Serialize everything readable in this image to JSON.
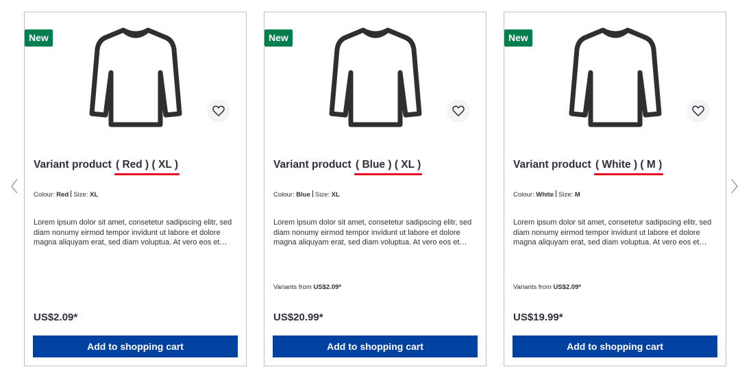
{
  "slider": {
    "prev_icon": "chevron-left-icon",
    "next_icon": "chevron-right-icon"
  },
  "products": [
    {
      "badge": "New",
      "image_icon": "long-sleeve-shirt-icon",
      "wishlist_icon": "heart-outline-icon",
      "name_prefix": "Variant product ",
      "name_variant": "( Red ) ( XL )",
      "colour_label": "Colour:",
      "colour_value": "Red",
      "size_label": "Size:",
      "size_value": "XL",
      "description": "Lorem ipsum dolor sit amet, consetetur sadipscing elitr, sed diam nonumy eirmod tempor invidunt ut labore et dolore magna aliquyam erat, sed diam voluptua. At vero eos et accusam et justo duo dolores et ea rebum.",
      "variants_label": "",
      "variants_price": "",
      "price": "US$2.09*",
      "cart_label": "Add to shopping cart"
    },
    {
      "badge": "New",
      "image_icon": "long-sleeve-shirt-icon",
      "wishlist_icon": "heart-outline-icon",
      "name_prefix": "Variant product ",
      "name_variant": "( Blue ) ( XL )",
      "colour_label": "Colour:",
      "colour_value": "Blue",
      "size_label": "Size:",
      "size_value": "XL",
      "description": "Lorem ipsum dolor sit amet, consetetur sadipscing elitr, sed diam nonumy eirmod tempor invidunt ut labore et dolore magna aliquyam erat, sed diam voluptua. At vero eos et accusam et justo duo dolores et ea rebum.",
      "variants_label": "Variants from",
      "variants_price": "US$2.09*",
      "price": "US$20.99*",
      "cart_label": "Add to shopping cart"
    },
    {
      "badge": "New",
      "image_icon": "long-sleeve-shirt-icon",
      "wishlist_icon": "heart-outline-icon",
      "name_prefix": "Variant product ",
      "name_variant": "( White ) ( M )",
      "colour_label": "Colour:",
      "colour_value": "White",
      "size_label": "Size:",
      "size_value": "M",
      "description": "Lorem ipsum dolor sit amet, consetetur sadipscing elitr, sed diam nonumy eirmod tempor invidunt ut labore et dolore magna aliquyam erat, sed diam voluptua. At vero eos et accusam et justo duo dolores et ea rebum.",
      "variants_label": "Variants from",
      "variants_price": "US$2.09*",
      "price": "US$19.99*",
      "cart_label": "Add to shopping cart"
    }
  ],
  "colors": {
    "badge": "#007e4e",
    "cart_button": "#0042a0",
    "highlight_underline": "#e2001a",
    "card_border": "#bcc1c7"
  }
}
